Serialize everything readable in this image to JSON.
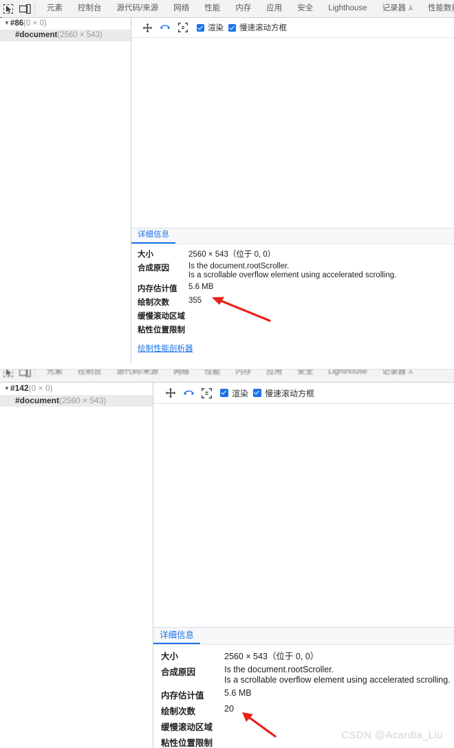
{
  "devtools": {
    "icons": {
      "inspect": "inspect-element-icon",
      "device": "device-toolbar-icon",
      "pan": "pan-icon",
      "rotate": "rotate-icon",
      "center": "reset-view-icon"
    },
    "tabs": [
      "元素",
      "控制台",
      "源代码/来源",
      "网络",
      "性能",
      "内存",
      "应用",
      "安全",
      "Lighthouse",
      "记录器",
      "性能数据分析"
    ],
    "recorder_badge": "⅄"
  },
  "panel1": {
    "tree": {
      "root_label": "#86",
      "root_size": "(0 × 0)",
      "child_label": "#document",
      "child_size": "(2560 × 543)",
      "twisty": "▼"
    },
    "toolbar": {
      "render_label": "渲染",
      "slow_scroll_label": "慢速滚动方框"
    },
    "details": {
      "tab_label": "详细信息",
      "rows": [
        {
          "key": "大小",
          "value": "2560 × 543（位于 0, 0）"
        },
        {
          "key": "合成原因",
          "value": "Is the document.rootScroller.",
          "value2": "Is a scrollable overflow element using accelerated scrolling."
        },
        {
          "key": "内存估计值",
          "value": "5.6 MB"
        },
        {
          "key": "绘制次数",
          "value": "355"
        },
        {
          "key": "缓慢滚动区域",
          "value": ""
        },
        {
          "key": "粘性位置限制",
          "value": ""
        }
      ],
      "link_label": "绘制性能剖析器"
    }
  },
  "panel2": {
    "tree": {
      "root_label": "#142",
      "root_size": "(0 × 0)",
      "child_label": "#document",
      "child_size": "(2560 × 543)",
      "twisty": "▼"
    },
    "toolbar": {
      "render_label": "渲染",
      "slow_scroll_label": "慢速滚动方框"
    },
    "details": {
      "tab_label": "详细信息",
      "rows": [
        {
          "key": "大小",
          "value": "2560 × 543（位于 0, 0）"
        },
        {
          "key": "合成原因",
          "value": "Is the document.rootScroller.",
          "value2": "Is a scrollable overflow element using accelerated scrolling."
        },
        {
          "key": "内存估计值",
          "value": "5.6 MB"
        },
        {
          "key": "绘制次数",
          "value": "20"
        },
        {
          "key": "缓慢滚动区域",
          "value": ""
        },
        {
          "key": "粘性位置限制",
          "value": ""
        }
      ]
    }
  },
  "annotation": {
    "arrow_color": "#e8201a",
    "arrow_count": 2
  },
  "watermark": "CSDN @Acardia_Liu"
}
